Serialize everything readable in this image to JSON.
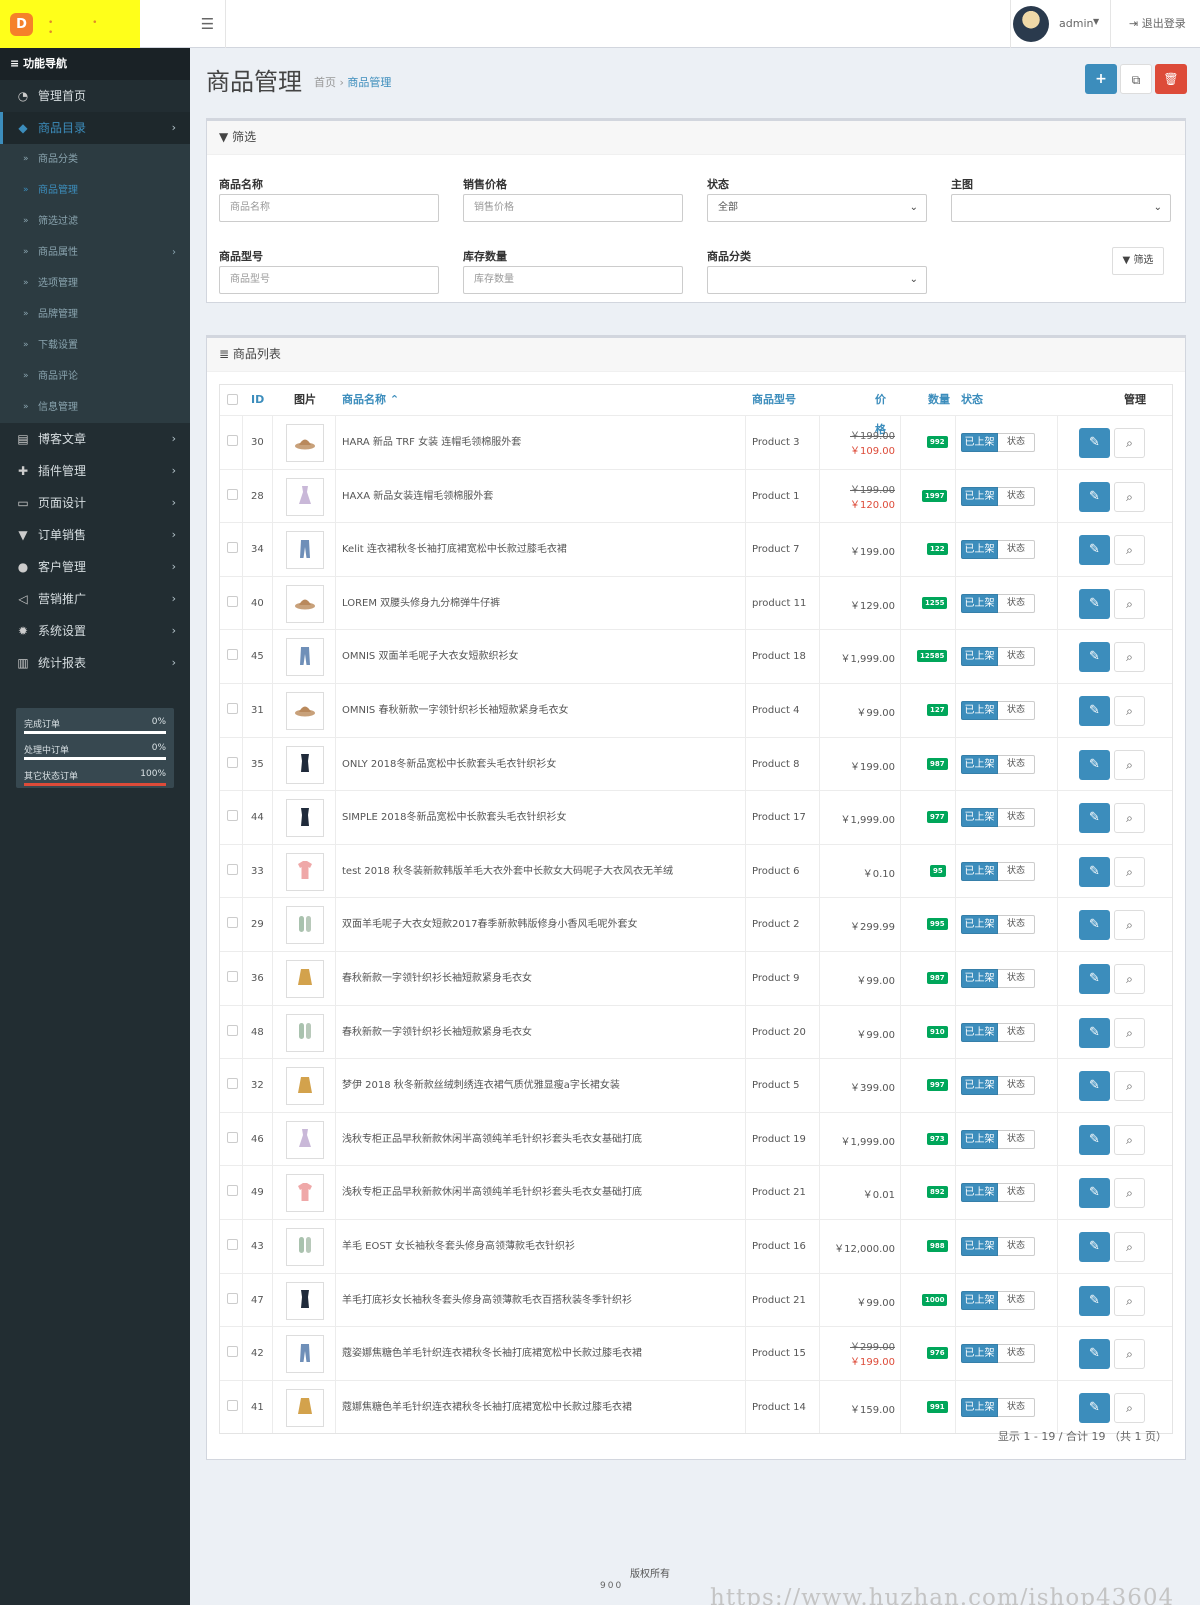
{
  "header": {
    "user": "admin",
    "logout": "退出登录",
    "menu_icon": "bars-icon",
    "logo_icon": "logo-d-icon"
  },
  "sidebar": {
    "title": "功能导航",
    "items": [
      {
        "label": "管理首页",
        "icon": "dashboard-icon",
        "has_children": false,
        "active": false
      },
      {
        "label": "商品目录",
        "icon": "tags-icon",
        "has_children": true,
        "active": true
      },
      {
        "label": "博客文章",
        "icon": "newspaper-icon",
        "has_children": true,
        "active": false
      },
      {
        "label": "插件管理",
        "icon": "puzzle-icon",
        "has_children": true,
        "active": false
      },
      {
        "label": "页面设计",
        "icon": "desktop-icon",
        "has_children": true,
        "active": false
      },
      {
        "label": "订单销售",
        "icon": "cart-icon",
        "has_children": true,
        "active": false
      },
      {
        "label": "客户管理",
        "icon": "user-icon",
        "has_children": true,
        "active": false
      },
      {
        "label": "营销推广",
        "icon": "share-icon",
        "has_children": true,
        "active": false
      },
      {
        "label": "系统设置",
        "icon": "gear-icon",
        "has_children": true,
        "active": false
      },
      {
        "label": "统计报表",
        "icon": "bar-chart-icon",
        "has_children": true,
        "active": false
      }
    ],
    "sub_items": [
      {
        "label": "商品分类",
        "active": false,
        "has_children": false
      },
      {
        "label": "商品管理",
        "active": true,
        "has_children": false
      },
      {
        "label": "筛选过滤",
        "active": false,
        "has_children": false
      },
      {
        "label": "商品属性",
        "active": false,
        "has_children": true
      },
      {
        "label": "选项管理",
        "active": false,
        "has_children": false
      },
      {
        "label": "品牌管理",
        "active": false,
        "has_children": false
      },
      {
        "label": "下载设置",
        "active": false,
        "has_children": false
      },
      {
        "label": "商品评论",
        "active": false,
        "has_children": false
      },
      {
        "label": "信息管理",
        "active": false,
        "has_children": false
      }
    ],
    "stats": [
      {
        "label": "完成订单",
        "value": "0%",
        "progress": 0,
        "color": "#ffffff"
      },
      {
        "label": "处理中订单",
        "value": "0%",
        "progress": 0,
        "color": "#ffffff"
      },
      {
        "label": "其它状态订单",
        "value": "100%",
        "progress": 1,
        "color": "#dd4b39"
      }
    ]
  },
  "page": {
    "title": "商品管理",
    "breadcrumb": [
      "首页",
      "商品管理"
    ],
    "accent": "#3c8dbc",
    "danger": "#dd4b39",
    "success": "#00a65a"
  },
  "toolbar": {
    "add_icon": "plus-icon",
    "copy_icon": "copy-icon",
    "delete_icon": "trash-icon"
  },
  "filter": {
    "title": "筛选",
    "fields": {
      "name": {
        "label": "商品名称",
        "placeholder": "商品名称"
      },
      "price": {
        "label": "销售价格",
        "placeholder": "销售价格"
      },
      "status": {
        "label": "状态",
        "value": "全部"
      },
      "image": {
        "label": "主图",
        "value": ""
      },
      "model": {
        "label": "商品型号",
        "placeholder": "商品型号"
      },
      "quantity": {
        "label": "库存数量",
        "placeholder": "库存数量"
      },
      "category": {
        "label": "商品分类",
        "value": ""
      }
    },
    "button": "筛选"
  },
  "list": {
    "title": "商品列表",
    "columns": {
      "id": "ID",
      "image": "图片",
      "name": "商品名称",
      "model": "商品型号",
      "price": "价格",
      "quantity": "数量",
      "status": "状态",
      "actions": "管理"
    },
    "status_on_label": "已上架",
    "status_toggle_label": "状态",
    "rows": [
      {
        "id": "30",
        "image": "hat",
        "name": "HARA 新品 TRF 女装 连帽毛领棉服外套",
        "model": "Product 3",
        "price": "￥199.00",
        "special": "￥109.00",
        "qty": "992"
      },
      {
        "id": "28",
        "image": "dress",
        "name": "HAXA 新品女装连帽毛领棉服外套",
        "model": "Product 1",
        "price": "￥199.00",
        "special": "￥120.00",
        "qty": "1997"
      },
      {
        "id": "34",
        "image": "jeans",
        "name": "Kelit 连衣裙秋冬长袖打底裙宽松中长款过膝毛衣裙",
        "model": "Product 7",
        "price": "￥199.00",
        "special": "",
        "qty": "122"
      },
      {
        "id": "40",
        "image": "hat",
        "name": "LOREM 双腰头修身九分棉弹牛仔裤",
        "model": "product 11",
        "price": "￥129.00",
        "special": "",
        "qty": "1255"
      },
      {
        "id": "45",
        "image": "jeans",
        "name": "OMNIS 双面羊毛呢子大衣女短款织衫女",
        "model": "Product 18",
        "price": "￥1,999.00",
        "special": "",
        "qty": "12585"
      },
      {
        "id": "31",
        "image": "hat",
        "name": "OMNIS 春秋新款一字领针织衫长袖短款紧身毛衣女",
        "model": "Product 4",
        "price": "￥99.00",
        "special": "",
        "qty": "127"
      },
      {
        "id": "35",
        "image": "dark",
        "name": "ONLY 2018冬新品宽松中长款套头毛衣针织衫女",
        "model": "Product 8",
        "price": "￥199.00",
        "special": "",
        "qty": "987"
      },
      {
        "id": "44",
        "image": "dark",
        "name": "SIMPLE 2018冬新品宽松中长款套头毛衣针织衫女",
        "model": "Product 17",
        "price": "￥1,999.00",
        "special": "",
        "qty": "977"
      },
      {
        "id": "33",
        "image": "pink",
        "name": "test 2018 秋冬装新款韩版羊毛大衣外套中长款女大码呢子大衣风衣无羊绒",
        "model": "Product 6",
        "price": "￥0.10",
        "special": "",
        "qty": "95"
      },
      {
        "id": "29",
        "image": "shoes",
        "name": "双面羊毛呢子大衣女短款2017春季新款韩版修身小香风毛呢外套女",
        "model": "Product 2",
        "price": "￥299.99",
        "special": "",
        "qty": "995"
      },
      {
        "id": "36",
        "image": "skirt",
        "name": "春秋新款一字领针织衫长袖短款紧身毛衣女",
        "model": "Product 9",
        "price": "￥99.00",
        "special": "",
        "qty": "987"
      },
      {
        "id": "48",
        "image": "shoes",
        "name": "春秋新款一字领针织衫长袖短款紧身毛衣女",
        "model": "Product 20",
        "price": "￥99.00",
        "special": "",
        "qty": "910"
      },
      {
        "id": "32",
        "image": "skirt",
        "name": "梦伊 2018 秋冬新款丝绒刺绣连衣裙气质优雅显瘦a字长裙女装",
        "model": "Product 5",
        "price": "￥399.00",
        "special": "",
        "qty": "997"
      },
      {
        "id": "46",
        "image": "dress",
        "name": "浅秋专柜正品早秋新款休闲半高领纯羊毛针织衫套头毛衣女基础打底",
        "model": "Product 19",
        "price": "￥1,999.00",
        "special": "",
        "qty": "973"
      },
      {
        "id": "49",
        "image": "pink",
        "name": "浅秋专柜正品早秋新款休闲半高领纯羊毛针织衫套头毛衣女基础打底",
        "model": "Product 21",
        "price": "￥0.01",
        "special": "",
        "qty": "892"
      },
      {
        "id": "43",
        "image": "shoes",
        "name": "羊毛 EOST 女长袖秋冬套头修身高领薄款毛衣针织衫",
        "model": "Product 16",
        "price": "￥12,000.00",
        "special": "",
        "qty": "988"
      },
      {
        "id": "47",
        "image": "dark",
        "name": "羊毛打底衫女长袖秋冬套头修身高领薄款毛衣百搭秋装冬季针织衫",
        "model": "Product 21",
        "price": "￥99.00",
        "special": "",
        "qty": "1000"
      },
      {
        "id": "42",
        "image": "jeans",
        "name": "蔻姿娜焦糖色羊毛针织连衣裙秋冬长袖打底裙宽松中长款过膝毛衣裙",
        "model": "Product 15",
        "price": "￥299.00",
        "special": "￥199.00",
        "qty": "976"
      },
      {
        "id": "41",
        "image": "skirt",
        "name": "蔻娜焦糖色羊毛针织连衣裙秋冬长袖打底裙宽松中长款过膝毛衣裙",
        "model": "Product 14",
        "price": "￥159.00",
        "special": "",
        "qty": "991"
      }
    ],
    "pagination": "显示 1 - 19 / 合计 19 （共 1 页）"
  },
  "footer": {
    "copyright": "版权所有",
    "version": "900",
    "watermark": "https://www.huzhan.com/ishop43604"
  }
}
